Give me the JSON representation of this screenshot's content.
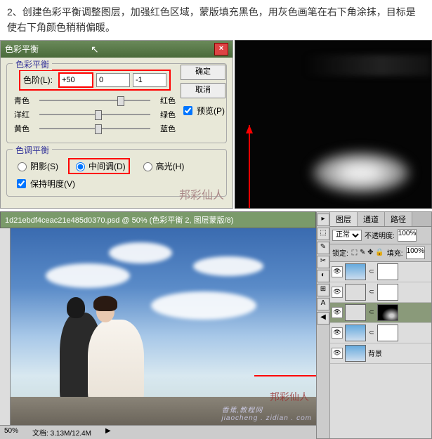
{
  "instruction": "2、创建色彩平衡调整图层，加强红色区域，蒙版填充黑色，用灰色画笔在右下角涂抹，目标是使右下角颜色稍稍偏暖。",
  "dialog": {
    "title": "色彩平衡",
    "group_balance": "色彩平衡",
    "levels_label": "色阶(L):",
    "levels": {
      "c": "+50",
      "m": "0",
      "y": "-1"
    },
    "pairs": [
      {
        "l": "青色",
        "r": "红色",
        "pos": 70
      },
      {
        "l": "洋红",
        "r": "绿色",
        "pos": 50
      },
      {
        "l": "黄色",
        "r": "蓝色",
        "pos": 50
      }
    ],
    "group_tone": "色调平衡",
    "radios": {
      "shadow": "阴影(S)",
      "mid": "中间调(D)",
      "high": "高光(H)"
    },
    "preserve": "保持明度(V)",
    "buttons": {
      "ok": "确定",
      "cancel": "取消",
      "preview": "预览(P)"
    }
  },
  "doc": {
    "title": "1d21ebdf4ceac21e485d0370.psd @ 50% (色彩平衡 2, 图层蒙版/8)",
    "status_left": "50%",
    "status_doc": "文档: 3.13M/12.4M"
  },
  "panels": {
    "tabs": [
      "图层",
      "通道",
      "路径"
    ],
    "blend": "正常",
    "opacity_lbl": "不透明度:",
    "opacity": "100%",
    "lock_lbl": "锁定:",
    "fill_lbl": "填充:",
    "fill": "100%",
    "layers": [
      {
        "name": "",
        "mask": true,
        "sel": false,
        "thumb": "sky"
      },
      {
        "name": "",
        "mask": true,
        "sel": false,
        "thumb": "adj"
      },
      {
        "name": "",
        "mask": true,
        "sel": true,
        "thumb": "adj"
      },
      {
        "name": "",
        "mask": true,
        "sel": false,
        "thumb": "sky"
      },
      {
        "name": "背景",
        "mask": false,
        "sel": false,
        "thumb": "sky"
      }
    ]
  },
  "watermark": "香蕉,教程网",
  "watermark_url": "jiaocheng . zidian . com",
  "signature": "邦彩仙人"
}
